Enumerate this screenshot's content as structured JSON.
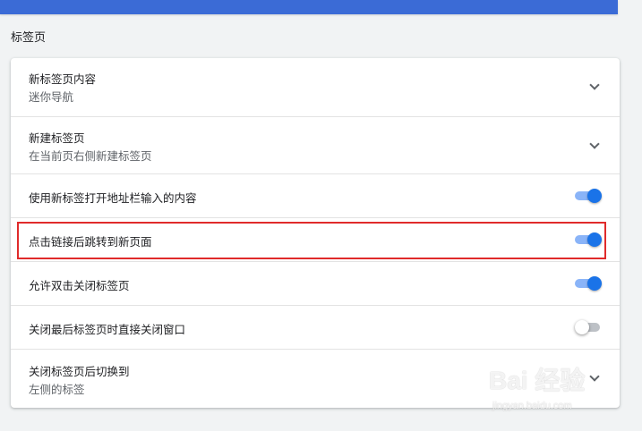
{
  "section": {
    "title": "标签页"
  },
  "rows": [
    {
      "label": "新标签页内容",
      "sub": "迷你导航",
      "control": "chevron-down-icon"
    },
    {
      "label": "新建标签页",
      "sub": "在当前页右侧新建标签页",
      "control": "chevron-down-icon"
    },
    {
      "label": "使用新标签打开地址栏输入的内容",
      "control": "toggle",
      "enabled": true
    },
    {
      "label": "点击链接后跳转到新页面",
      "control": "toggle",
      "enabled": true,
      "highlighted": true
    },
    {
      "label": "允许双击关闭标签页",
      "control": "toggle",
      "enabled": true
    },
    {
      "label": "关闭最后标签页时直接关闭窗口",
      "control": "toggle",
      "enabled": false
    },
    {
      "label": "关闭标签页后切换到",
      "sub": "左侧的标签",
      "control": "chevron-down-icon"
    }
  ],
  "watermark": {
    "main": "Bai 经验",
    "sub": "jingyan.baidu.com"
  },
  "colors": {
    "accent": "#1a73e8",
    "accent_track": "#8ab4f8",
    "highlight": "#e02b2b",
    "top_bar": "#3b6bd6"
  }
}
